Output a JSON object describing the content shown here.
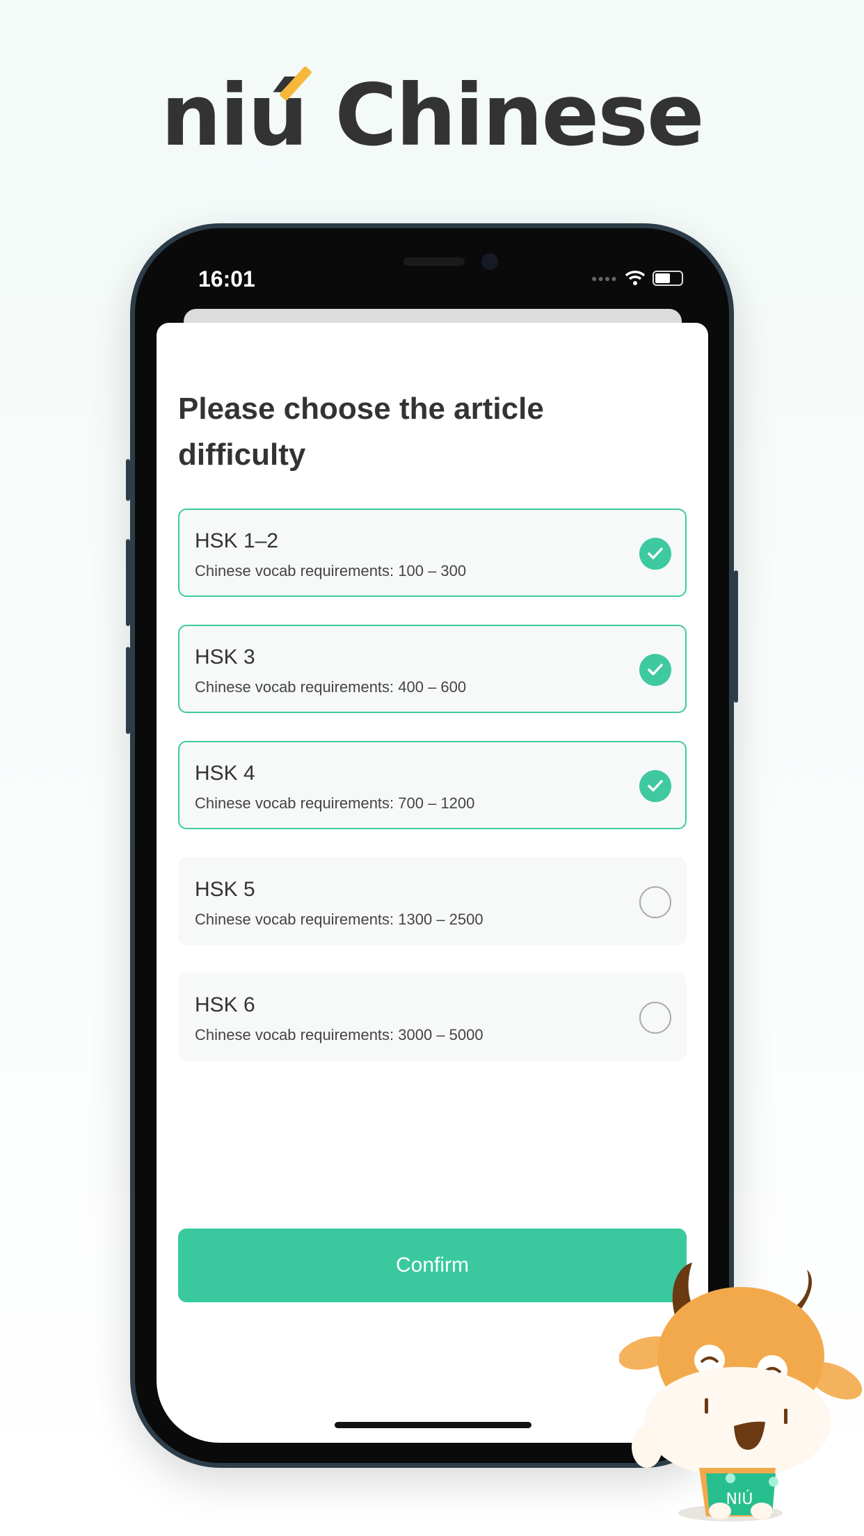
{
  "logo": {
    "text": "niú Chinese"
  },
  "status_bar": {
    "time": "16:01"
  },
  "page": {
    "title": "Please choose the article difficulty"
  },
  "options": [
    {
      "name": "HSK 1–2",
      "sub": "Chinese vocab requirements: 100 – 300",
      "selected": true
    },
    {
      "name": "HSK 3",
      "sub": "Chinese vocab requirements: 400 – 600",
      "selected": true
    },
    {
      "name": "HSK 4",
      "sub": "Chinese vocab requirements: 700 – 1200",
      "selected": true
    },
    {
      "name": "HSK 5",
      "sub": "Chinese vocab requirements: 1300 – 2500",
      "selected": false
    },
    {
      "name": "HSK 6",
      "sub": "Chinese vocab requirements: 3000 – 5000",
      "selected": false
    }
  ],
  "confirm_label": "Confirm",
  "mascot": {
    "overall_text": "NIÚ"
  },
  "colors": {
    "accent": "#3ac99f",
    "text": "#333333"
  }
}
